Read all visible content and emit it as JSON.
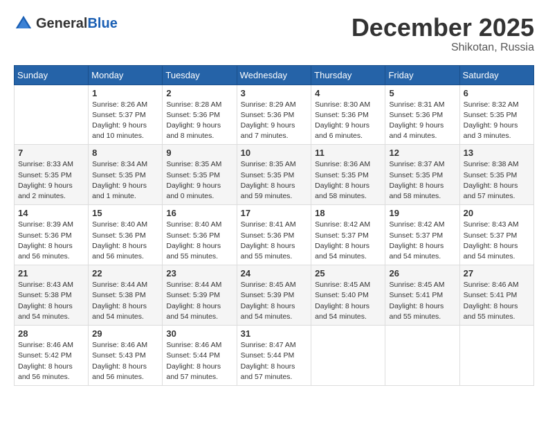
{
  "header": {
    "logo_general": "General",
    "logo_blue": "Blue",
    "title": "December 2025",
    "subtitle": "Shikotan, Russia"
  },
  "weekdays": [
    "Sunday",
    "Monday",
    "Tuesday",
    "Wednesday",
    "Thursday",
    "Friday",
    "Saturday"
  ],
  "weeks": [
    [
      {
        "day": "",
        "info": ""
      },
      {
        "day": "1",
        "info": "Sunrise: 8:26 AM\nSunset: 5:37 PM\nDaylight: 9 hours\nand 10 minutes."
      },
      {
        "day": "2",
        "info": "Sunrise: 8:28 AM\nSunset: 5:36 PM\nDaylight: 9 hours\nand 8 minutes."
      },
      {
        "day": "3",
        "info": "Sunrise: 8:29 AM\nSunset: 5:36 PM\nDaylight: 9 hours\nand 7 minutes."
      },
      {
        "day": "4",
        "info": "Sunrise: 8:30 AM\nSunset: 5:36 PM\nDaylight: 9 hours\nand 6 minutes."
      },
      {
        "day": "5",
        "info": "Sunrise: 8:31 AM\nSunset: 5:36 PM\nDaylight: 9 hours\nand 4 minutes."
      },
      {
        "day": "6",
        "info": "Sunrise: 8:32 AM\nSunset: 5:35 PM\nDaylight: 9 hours\nand 3 minutes."
      }
    ],
    [
      {
        "day": "7",
        "info": "Sunrise: 8:33 AM\nSunset: 5:35 PM\nDaylight: 9 hours\nand 2 minutes."
      },
      {
        "day": "8",
        "info": "Sunrise: 8:34 AM\nSunset: 5:35 PM\nDaylight: 9 hours\nand 1 minute."
      },
      {
        "day": "9",
        "info": "Sunrise: 8:35 AM\nSunset: 5:35 PM\nDaylight: 9 hours\nand 0 minutes."
      },
      {
        "day": "10",
        "info": "Sunrise: 8:35 AM\nSunset: 5:35 PM\nDaylight: 8 hours\nand 59 minutes."
      },
      {
        "day": "11",
        "info": "Sunrise: 8:36 AM\nSunset: 5:35 PM\nDaylight: 8 hours\nand 58 minutes."
      },
      {
        "day": "12",
        "info": "Sunrise: 8:37 AM\nSunset: 5:35 PM\nDaylight: 8 hours\nand 58 minutes."
      },
      {
        "day": "13",
        "info": "Sunrise: 8:38 AM\nSunset: 5:35 PM\nDaylight: 8 hours\nand 57 minutes."
      }
    ],
    [
      {
        "day": "14",
        "info": "Sunrise: 8:39 AM\nSunset: 5:36 PM\nDaylight: 8 hours\nand 56 minutes."
      },
      {
        "day": "15",
        "info": "Sunrise: 8:40 AM\nSunset: 5:36 PM\nDaylight: 8 hours\nand 56 minutes."
      },
      {
        "day": "16",
        "info": "Sunrise: 8:40 AM\nSunset: 5:36 PM\nDaylight: 8 hours\nand 55 minutes."
      },
      {
        "day": "17",
        "info": "Sunrise: 8:41 AM\nSunset: 5:36 PM\nDaylight: 8 hours\nand 55 minutes."
      },
      {
        "day": "18",
        "info": "Sunrise: 8:42 AM\nSunset: 5:37 PM\nDaylight: 8 hours\nand 54 minutes."
      },
      {
        "day": "19",
        "info": "Sunrise: 8:42 AM\nSunset: 5:37 PM\nDaylight: 8 hours\nand 54 minutes."
      },
      {
        "day": "20",
        "info": "Sunrise: 8:43 AM\nSunset: 5:37 PM\nDaylight: 8 hours\nand 54 minutes."
      }
    ],
    [
      {
        "day": "21",
        "info": "Sunrise: 8:43 AM\nSunset: 5:38 PM\nDaylight: 8 hours\nand 54 minutes."
      },
      {
        "day": "22",
        "info": "Sunrise: 8:44 AM\nSunset: 5:38 PM\nDaylight: 8 hours\nand 54 minutes."
      },
      {
        "day": "23",
        "info": "Sunrise: 8:44 AM\nSunset: 5:39 PM\nDaylight: 8 hours\nand 54 minutes."
      },
      {
        "day": "24",
        "info": "Sunrise: 8:45 AM\nSunset: 5:39 PM\nDaylight: 8 hours\nand 54 minutes."
      },
      {
        "day": "25",
        "info": "Sunrise: 8:45 AM\nSunset: 5:40 PM\nDaylight: 8 hours\nand 54 minutes."
      },
      {
        "day": "26",
        "info": "Sunrise: 8:45 AM\nSunset: 5:41 PM\nDaylight: 8 hours\nand 55 minutes."
      },
      {
        "day": "27",
        "info": "Sunrise: 8:46 AM\nSunset: 5:41 PM\nDaylight: 8 hours\nand 55 minutes."
      }
    ],
    [
      {
        "day": "28",
        "info": "Sunrise: 8:46 AM\nSunset: 5:42 PM\nDaylight: 8 hours\nand 56 minutes."
      },
      {
        "day": "29",
        "info": "Sunrise: 8:46 AM\nSunset: 5:43 PM\nDaylight: 8 hours\nand 56 minutes."
      },
      {
        "day": "30",
        "info": "Sunrise: 8:46 AM\nSunset: 5:44 PM\nDaylight: 8 hours\nand 57 minutes."
      },
      {
        "day": "31",
        "info": "Sunrise: 8:47 AM\nSunset: 5:44 PM\nDaylight: 8 hours\nand 57 minutes."
      },
      {
        "day": "",
        "info": ""
      },
      {
        "day": "",
        "info": ""
      },
      {
        "day": "",
        "info": ""
      }
    ]
  ]
}
